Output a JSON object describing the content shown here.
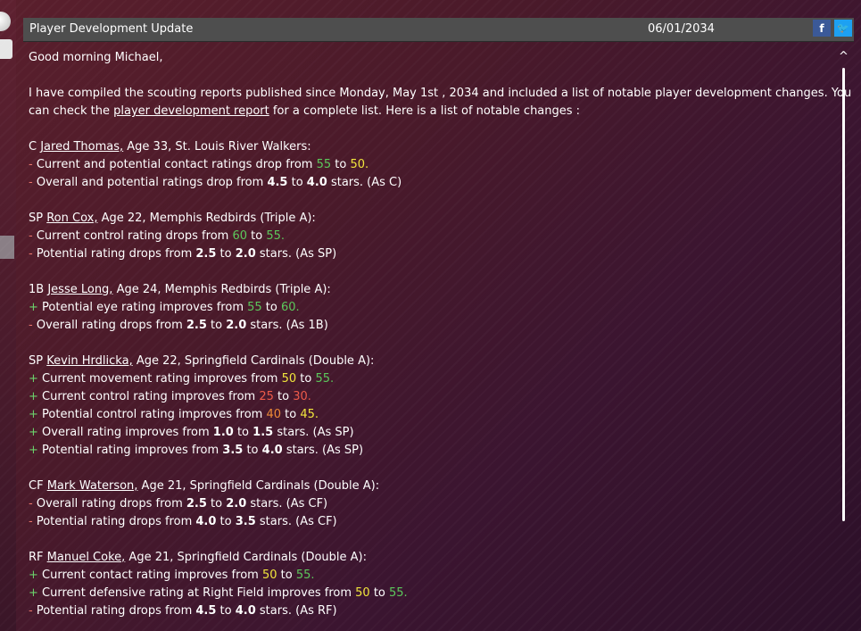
{
  "header": {
    "title": "Player Development Update",
    "date": "06/01/2034",
    "facebook_glyph": "f",
    "twitter_glyph": "🐦"
  },
  "message": {
    "greeting": "Good morning Michael,",
    "intro_part1": "I have compiled the scouting reports published since Monday, May 1st , 2034 and included a list of notable player development changes. You",
    "intro_part2_prefix": "can check the ",
    "intro_link": "player development report",
    "intro_part2_suffix": " for a complete list. Here is a list of notable changes :"
  },
  "players": [
    {
      "position": "C",
      "name": "Jared Thomas,",
      "info": " Age 33, St. Louis River Walkers:",
      "changes": [
        {
          "sign": "-",
          "text": " Current and potential contact ratings drop from ",
          "v1": "55",
          "c1": "g",
          "mid": " to ",
          "v2": "50.",
          "c2": "y",
          "tail": ""
        },
        {
          "sign": "-",
          "text": " Overall and potential ratings drop from ",
          "v1": "4.5",
          "c1": "b",
          "mid": " to ",
          "v2": "4.0",
          "c2": "b",
          "tail": " stars. (As C)"
        }
      ]
    },
    {
      "position": "SP",
      "name": "Ron Cox,",
      "info": " Age 22, Memphis Redbirds (Triple A):",
      "changes": [
        {
          "sign": "-",
          "text": " Current control rating drops from ",
          "v1": "60",
          "c1": "g",
          "mid": " to ",
          "v2": "55.",
          "c2": "g",
          "tail": ""
        },
        {
          "sign": "-",
          "text": " Potential rating drops from ",
          "v1": "2.5",
          "c1": "b",
          "mid": " to ",
          "v2": "2.0",
          "c2": "b",
          "tail": " stars. (As SP)"
        }
      ]
    },
    {
      "position": "1B",
      "name": "Jesse Long,",
      "info": " Age 24, Memphis Redbirds (Triple A):",
      "changes": [
        {
          "sign": "+",
          "text": " Potential eye rating improves from ",
          "v1": "55",
          "c1": "g",
          "mid": " to ",
          "v2": "60.",
          "c2": "g",
          "tail": ""
        },
        {
          "sign": "-",
          "text": " Overall rating drops from ",
          "v1": "2.5",
          "c1": "b",
          "mid": " to ",
          "v2": "2.0",
          "c2": "b",
          "tail": " stars. (As 1B)"
        }
      ]
    },
    {
      "position": "SP",
      "name": "Kevin Hrdlicka,",
      "info": " Age 22, Springfield Cardinals (Double A):",
      "changes": [
        {
          "sign": "+",
          "text": " Current movement rating improves from ",
          "v1": "50",
          "c1": "y",
          "mid": " to ",
          "v2": "55.",
          "c2": "g",
          "tail": ""
        },
        {
          "sign": "+",
          "text": " Current control rating improves from ",
          "v1": "25",
          "c1": "r",
          "mid": " to ",
          "v2": "30.",
          "c2": "r",
          "tail": ""
        },
        {
          "sign": "+",
          "text": " Potential control rating improves from ",
          "v1": "40",
          "c1": "o",
          "mid": " to ",
          "v2": "45.",
          "c2": "y",
          "tail": ""
        },
        {
          "sign": "+",
          "text": " Overall rating improves from ",
          "v1": "1.0",
          "c1": "b",
          "mid": " to ",
          "v2": "1.5",
          "c2": "b",
          "tail": " stars. (As SP)"
        },
        {
          "sign": "+",
          "text": " Potential rating improves from ",
          "v1": "3.5",
          "c1": "b",
          "mid": " to ",
          "v2": "4.0",
          "c2": "b",
          "tail": " stars. (As SP)"
        }
      ]
    },
    {
      "position": "CF",
      "name": "Mark Waterson,",
      "info": " Age 21, Springfield Cardinals (Double A):",
      "changes": [
        {
          "sign": "-",
          "text": " Overall rating drops from ",
          "v1": "2.5",
          "c1": "b",
          "mid": " to ",
          "v2": "2.0",
          "c2": "b",
          "tail": " stars. (As CF)"
        },
        {
          "sign": "-",
          "text": " Potential rating drops from ",
          "v1": "4.0",
          "c1": "b",
          "mid": " to ",
          "v2": "3.5",
          "c2": "b",
          "tail": " stars. (As CF)"
        }
      ]
    },
    {
      "position": "RF",
      "name": "Manuel Coke,",
      "info": " Age 21, Springfield Cardinals (Double A):",
      "changes": [
        {
          "sign": "+",
          "text": " Current contact rating improves from ",
          "v1": "50",
          "c1": "y",
          "mid": " to ",
          "v2": "55.",
          "c2": "g",
          "tail": ""
        },
        {
          "sign": "+",
          "text": " Current defensive rating at Right Field improves from ",
          "v1": "50",
          "c1": "y",
          "mid": " to ",
          "v2": "55.",
          "c2": "g",
          "tail": ""
        },
        {
          "sign": "-",
          "text": " Potential rating drops from ",
          "v1": "4.5",
          "c1": "b",
          "mid": " to ",
          "v2": "4.0",
          "c2": "b",
          "tail": " stars. (As RF)"
        }
      ]
    }
  ],
  "scroll": {
    "up_glyph": "^"
  },
  "colors": {
    "positive": "#6bd16b",
    "negative": "#e8756b",
    "good_rating": "#5cc85c",
    "average_rating": "#f0e53c",
    "poor_rating": "#ee5a4a",
    "fair_rating": "#ee8a36"
  }
}
